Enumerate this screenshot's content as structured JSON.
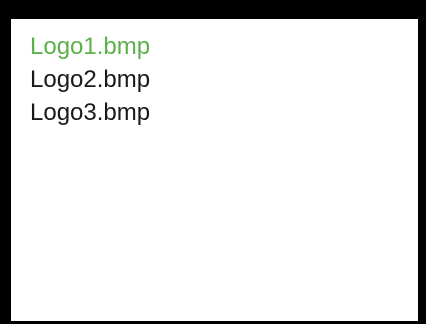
{
  "file_list": {
    "items": [
      {
        "label": "Logo1.bmp",
        "selected": true
      },
      {
        "label": "Logo2.bmp",
        "selected": false
      },
      {
        "label": "Logo3.bmp",
        "selected": false
      }
    ],
    "colors": {
      "selected": "#5cb14b",
      "normal": "#1a1a1a",
      "background": "#ffffff",
      "frame": "#000000"
    }
  }
}
